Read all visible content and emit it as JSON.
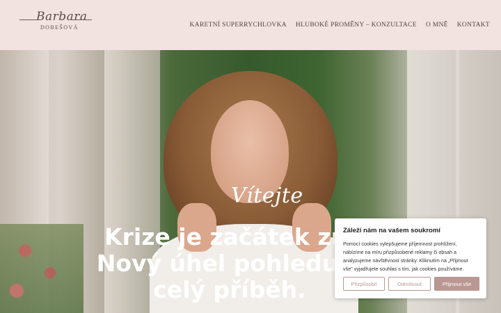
{
  "header": {
    "logo_script": "Barbara",
    "logo_sub": "DOBEŠOVÁ",
    "nav": [
      {
        "label": "KARETNÍ SUPERRYCHLOVKA"
      },
      {
        "label": "HLUBOKÉ PROMĚNY – KONZULTACE"
      },
      {
        "label": "O MNĚ"
      },
      {
        "label": "KONTAKT"
      }
    ]
  },
  "hero": {
    "greeting": "Vítejte",
    "headline": [
      "Krize je začátek zm",
      "Nový úhel pohledu n",
      "celý příběh."
    ]
  },
  "cookie": {
    "title": "Záleží nám na vašem soukromí",
    "text": "Pomocí cookies vylepšujeme příjemnost prohlížení, nabízíme na míru přizpůsobené reklamy či obsah a analyzujeme návštěvnost stránky. Kliknutím na „Přijmout vše\" vyjadřujete souhlas s tím, jak cookies používáme.",
    "btn_customize": "Přizpůsobit",
    "btn_reject": "Odmítnout",
    "btn_accept": "Přijmout vše",
    "accent_color": "#b99792"
  }
}
